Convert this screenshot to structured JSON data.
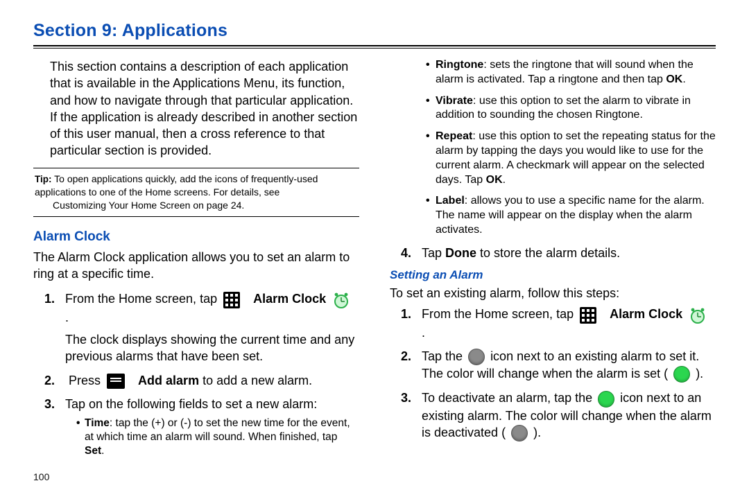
{
  "title": "Section 9: Applications",
  "intro": "This section contains a description of each application that is available in the Applications Menu, its function, and how to navigate through that particular application. If the application is already described in another section of this user manual, then a cross reference to that particular section is provided.",
  "tip": {
    "label": "Tip:",
    "body_start": "To open applications quickly, add the icons of frequently-used applications to one of the Home screens. For details, see ",
    "link": "Customizing Your Home Screen",
    "body_end": " on page 24."
  },
  "alarm": {
    "heading": "Alarm Clock",
    "intro": "The Alarm Clock application allows you to set an alarm to ring at a specific time.",
    "step1_a": "From the Home screen, tap ",
    "step1_label": "Alarm Clock",
    "step1_cont": "The clock displays showing the current time and any previous alarms that have been set.",
    "step2_a": "Press ",
    "step2_b": "Add alarm",
    "step2_c": " to add a new alarm.",
    "step3": "Tap on the following fields to set a new alarm:",
    "bul_time_label": "Time",
    "bul_time": ": tap the (+) or (-) to set the new time for the event, at which time an alarm will sound. When finished, tap ",
    "bul_time_end": "Set",
    "bul_ringtone_label": "Ringtone",
    "bul_ringtone": ": sets the ringtone that will sound when the alarm is activated. Tap a ringtone and then tap ",
    "bul_ringtone_end": "OK",
    "bul_vibrate_label": "Vibrate",
    "bul_vibrate": ": use this option to set the alarm to vibrate in addition to sounding the chosen Ringtone.",
    "bul_repeat_label": "Repeat",
    "bul_repeat": ": use this option to set the repeating status for the alarm by tapping the days you would like to use for the current alarm. A checkmark will appear on the selected days. Tap ",
    "bul_repeat_end": "OK",
    "bul_label_label": "Label",
    "bul_label": ": allows you to use a specific name for the alarm. The name will appear on the display when the alarm activates.",
    "step4_a": "Tap ",
    "step4_b": "Done",
    "step4_c": " to store the alarm details."
  },
  "setting": {
    "heading": "Setting an Alarm",
    "intro": "To set an existing alarm, follow this steps:",
    "step1_a": "From the Home screen, tap ",
    "step1_label": "Alarm Clock",
    "step2_a": "Tap the ",
    "step2_b": " icon next to an existing alarm to set it. The color will change when the alarm is set ( ",
    "step2_c": " ).",
    "step3_a": "To deactivate an alarm, tap the ",
    "step3_b": " icon next to an existing alarm. The color will change when the alarm is deactivated ( ",
    "step3_c": " )."
  },
  "page_number": "100"
}
